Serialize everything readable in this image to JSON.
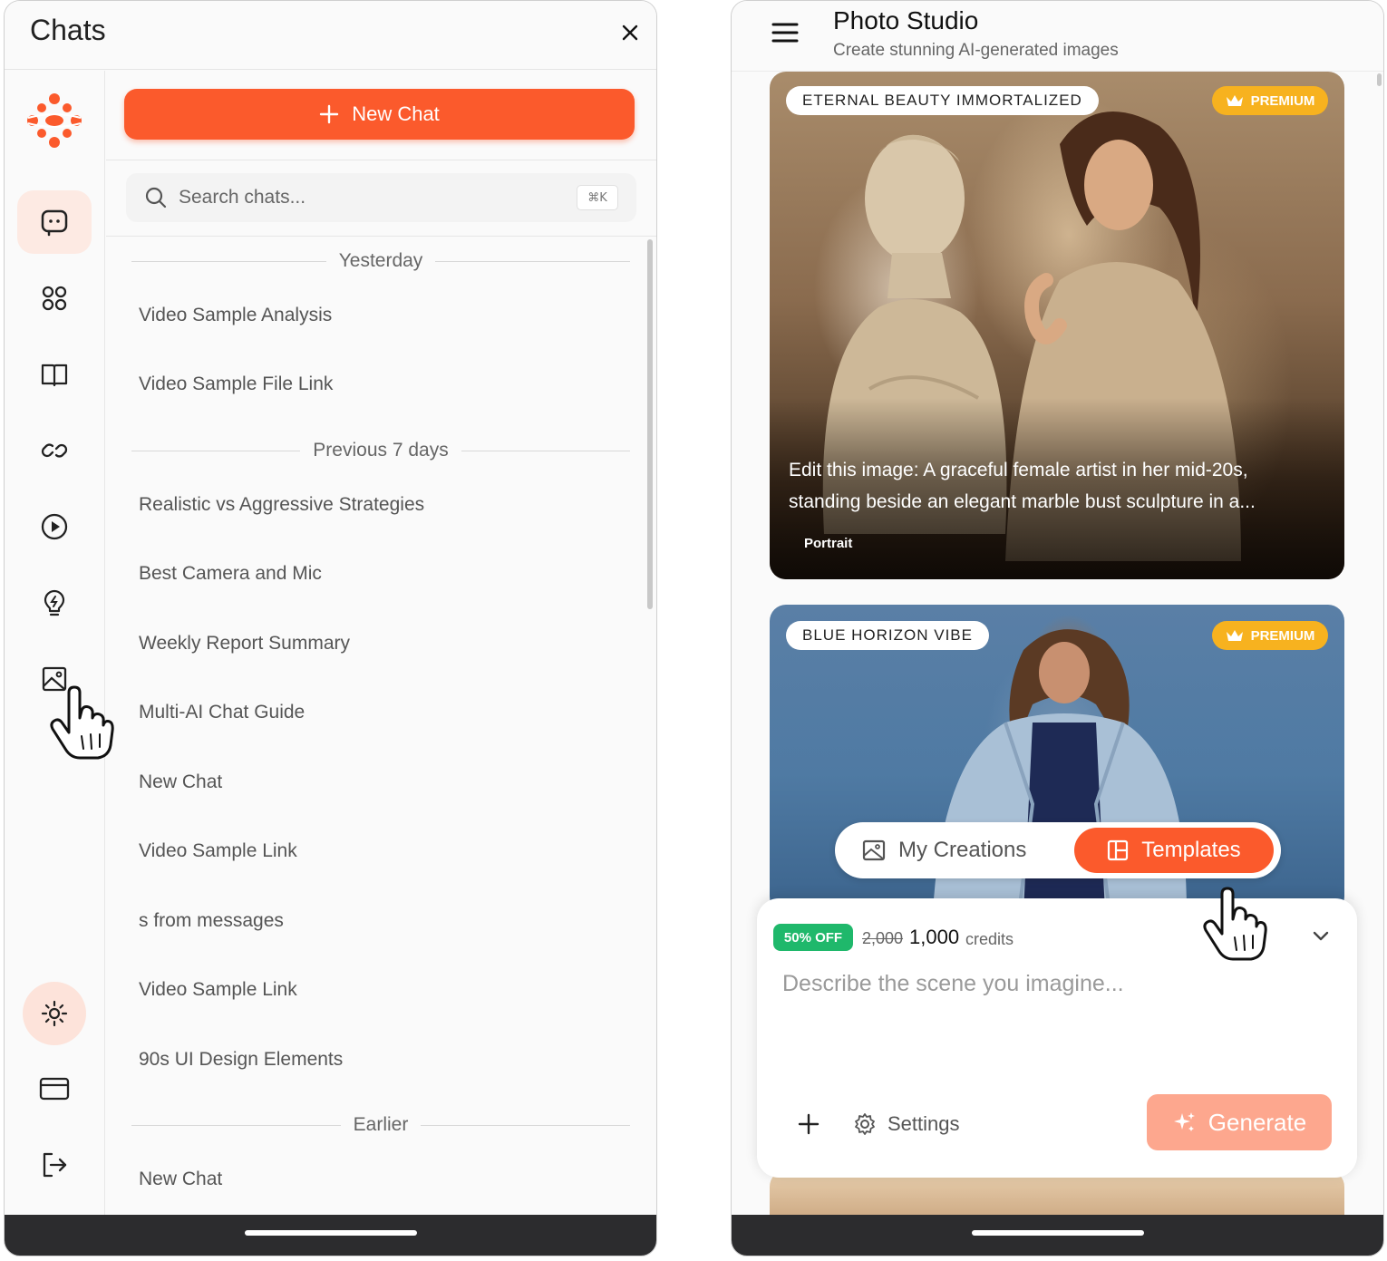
{
  "left_panel": {
    "title": "Chats",
    "new_chat_label": "New Chat",
    "search": {
      "placeholder": "Search chats...",
      "shortcut": "⌘K"
    },
    "sections": [
      {
        "label": "Yesterday",
        "items": [
          "Video Sample Analysis",
          "Video Sample File Link"
        ]
      },
      {
        "label": "Previous 7 days",
        "items": [
          "Realistic vs Aggressive Strategies",
          "Best Camera and Mic",
          "Weekly Report Summary",
          "Multi-AI Chat Guide",
          "New Chat",
          "Video Sample Link",
          "s from messages",
          "Video Sample Link",
          "90s UI Design Elements"
        ]
      },
      {
        "label": "Earlier",
        "items": [
          "New Chat"
        ]
      }
    ],
    "rail_icons": [
      "chat-bubble-icon",
      "apps-grid-icon",
      "book-icon",
      "link-icon",
      "play-circle-icon",
      "lightbulb-icon",
      "image-icon",
      "sun-icon",
      "credit-card-icon",
      "logout-icon"
    ]
  },
  "right_panel": {
    "title": "Photo Studio",
    "subtitle": "Create stunning AI-generated images",
    "cards": [
      {
        "tag": "ETERNAL BEAUTY IMMORTALIZED",
        "badge": "PREMIUM",
        "description": "Edit this image: A graceful female artist in her mid-20s, standing beside an elegant marble bust sculpture in a...",
        "category": "Portrait"
      },
      {
        "tag": "BLUE HORIZON VIBE",
        "badge": "PREMIUM"
      }
    ],
    "tabs": {
      "creations": "My Creations",
      "templates": "Templates",
      "active": "Templates"
    },
    "composer": {
      "discount": "50% OFF",
      "old_price": "2,000",
      "new_price": "1,000",
      "credits_label": "credits",
      "placeholder": "Describe the scene you imagine...",
      "settings_label": "Settings",
      "generate_label": "Generate"
    }
  },
  "colors": {
    "accent": "#fb5a2c",
    "premium": "#f7b21f",
    "discount": "#1fb86b",
    "generate_disabled": "#fda78e"
  }
}
